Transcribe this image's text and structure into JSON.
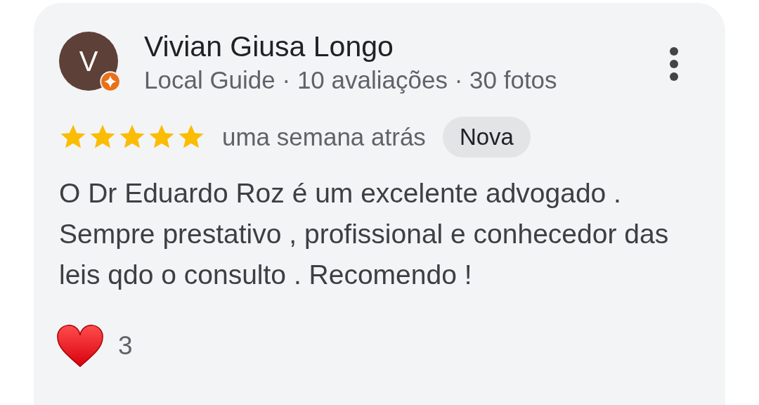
{
  "review": {
    "avatar_letter": "V",
    "name": "Vivian Giusa Longo",
    "subtitle": "Local Guide · 10 avaliações · 30 fotos",
    "stars": 5,
    "time": "uma semana atrás",
    "badge": "Nova",
    "text": "O Dr Eduardo Roz é um excelente advogado . Sempre prestativo , profissional e conhecedor das leis qdo o consulto . Recomendo !",
    "reaction_count": "3"
  }
}
